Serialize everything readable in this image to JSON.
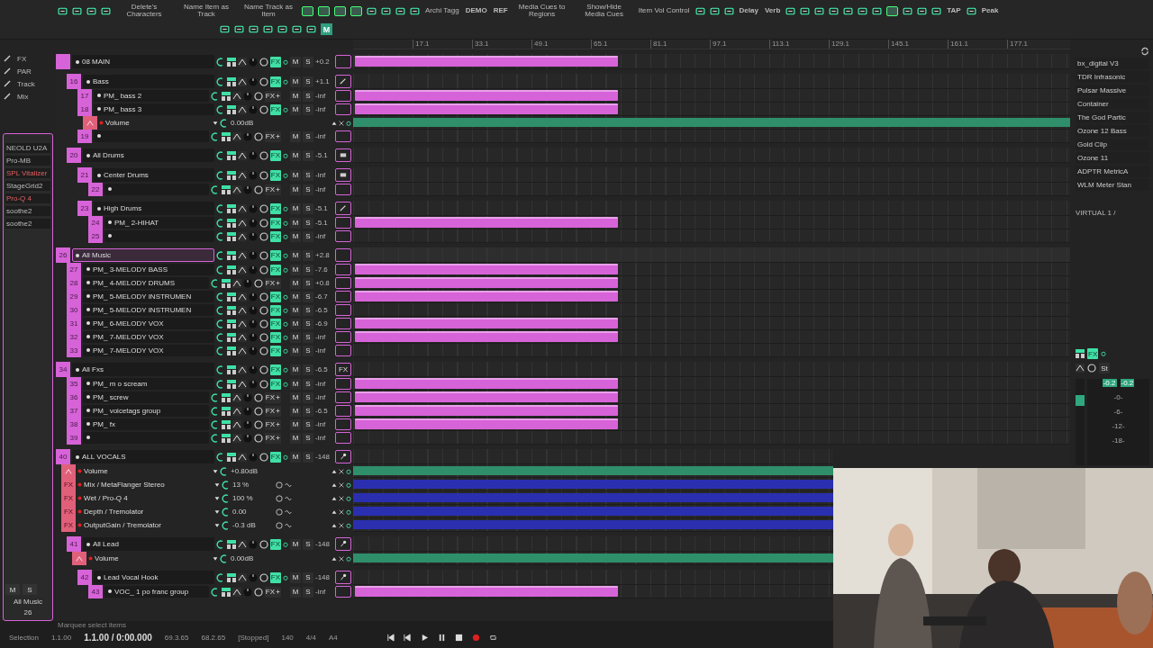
{
  "toolbar": [
    {
      "kind": "icon"
    },
    {
      "kind": "icon"
    },
    {
      "kind": "icon"
    },
    {
      "kind": "icon"
    },
    {
      "kind": "text",
      "label": "Delete's Characters"
    },
    {
      "kind": "text",
      "label": "Name Item as Track"
    },
    {
      "kind": "text",
      "label": "Name Track as Item"
    },
    {
      "kind": "toggle"
    },
    {
      "kind": "toggle"
    },
    {
      "kind": "toggle"
    },
    {
      "kind": "toggle"
    },
    {
      "kind": "icon"
    },
    {
      "kind": "icon"
    },
    {
      "kind": "icon"
    },
    {
      "kind": "icon"
    },
    {
      "kind": "text",
      "label": "Archi Tagg"
    },
    {
      "kind": "text",
      "label": "DEMO"
    },
    {
      "kind": "text",
      "label": "REF"
    },
    {
      "kind": "text",
      "label": "Media Cues to Regions"
    },
    {
      "kind": "text",
      "label": "Show/Hide Media Cues"
    },
    {
      "kind": "text",
      "label": "Item Vol Control"
    },
    {
      "kind": "icon"
    },
    {
      "kind": "icon"
    },
    {
      "kind": "icon"
    },
    {
      "kind": "text",
      "label": "Delay"
    },
    {
      "kind": "text",
      "label": "Verb"
    },
    {
      "kind": "icon"
    },
    {
      "kind": "icon"
    },
    {
      "kind": "icon"
    },
    {
      "kind": "icon"
    },
    {
      "kind": "icon"
    },
    {
      "kind": "icon"
    },
    {
      "kind": "icon"
    },
    {
      "kind": "toggle"
    },
    {
      "kind": "icon"
    },
    {
      "kind": "icon"
    },
    {
      "kind": "icon"
    },
    {
      "kind": "text",
      "label": "TAP"
    },
    {
      "kind": "icon"
    },
    {
      "kind": "text",
      "label": "Peak"
    }
  ],
  "toolbar2": [
    {
      "kind": "icon"
    },
    {
      "kind": "icon"
    },
    {
      "kind": "icon"
    },
    {
      "kind": "icon"
    },
    {
      "kind": "icon"
    },
    {
      "kind": "icon"
    },
    {
      "kind": "icon"
    },
    {
      "kind": "text",
      "label": "M"
    }
  ],
  "left_tools": {
    "labels": [
      "FX",
      "PAR",
      "Track",
      "Mix"
    ]
  },
  "left_strip": {
    "fx": [
      {
        "name": "NEOLD U2A",
        "enabled": true
      },
      {
        "name": "Pro-MB",
        "enabled": true
      },
      {
        "name": "SPL Vitalizer",
        "enabled": false
      },
      {
        "name": "StageGrid2",
        "enabled": true
      },
      {
        "name": "Pro-Q 4",
        "enabled": false
      },
      {
        "name": "soothe2",
        "enabled": true
      },
      {
        "name": "soothe2",
        "enabled": true
      }
    ],
    "buttons": [
      "M",
      "S"
    ],
    "track_name": "All Music",
    "track_number": "26"
  },
  "ruler": [
    "17.1",
    "33.1",
    "49.1",
    "65.1",
    "81.1",
    "97.1",
    "113.1",
    "129.1",
    "145.1",
    "161.1",
    "177.1"
  ],
  "tracks": [
    {
      "name": "08 MAIN",
      "reading": "+0.2",
      "fx": "FX",
      "mute": "M",
      "solo": "S",
      "fx_on": true,
      "selected": false,
      "items": true,
      "children": [
        {
          "number": "16",
          "name": "Bass",
          "reading": "+1.1",
          "fx": "FX",
          "mute": "M",
          "solo": "S",
          "fx_on": true,
          "selected": false,
          "items": false,
          "thumb": {
            "kind": "guitar"
          },
          "children": [
            {
              "number": "17",
              "name": "PM_ bass 2",
              "reading": "-inf",
              "fx": "FX",
              "mute": "M",
              "solo": "S",
              "fx_on": false,
              "selected": false,
              "items": true
            },
            {
              "number": "18",
              "name": "PM_ bass 3",
              "reading": "-inf",
              "fx": "FX",
              "mute": "M",
              "solo": "S",
              "fx_on": true,
              "selected": false,
              "items": true,
              "envelopes": [
                {
                  "kind": "volume",
                  "name": "Volume",
                  "value": "0.00dB"
                }
              ]
            },
            {
              "number": "19",
              "reading": "-inf",
              "fx": "FX",
              "mute": "M",
              "solo": "S",
              "fx_on": false,
              "selected": false,
              "items": false
            }
          ]
        },
        {
          "number": "20",
          "name": "All Drums",
          "reading": "-5.1",
          "fx": "FX",
          "mute": "M",
          "solo": "S",
          "fx_on": true,
          "selected": false,
          "items": false,
          "thumb": {
            "kind": "drum"
          },
          "children": [
            {
              "number": "21",
              "name": "Center Drums",
              "reading": "-inf",
              "fx": "FX",
              "mute": "M",
              "solo": "S",
              "fx_on": true,
              "selected": false,
              "items": false,
              "thumb": {
                "kind": "drum"
              },
              "children": [
                {
                  "number": "22",
                  "reading": "-inf",
                  "fx": "FX",
                  "mute": "M",
                  "solo": "S",
                  "fx_on": false,
                  "selected": false,
                  "items": false
                }
              ]
            },
            {
              "number": "23",
              "name": "High Drums",
              "reading": "-5.1",
              "fx": "FX",
              "mute": "M",
              "solo": "S",
              "fx_on": true,
              "selected": false,
              "items": false,
              "thumb": {
                "kind": "guitar"
              },
              "children": [
                {
                  "number": "24",
                  "name": "PM_ 2-HIHAT",
                  "reading": "-5.1",
                  "fx": "FX",
                  "mute": "M",
                  "solo": "S",
                  "fx_on": true,
                  "selected": false,
                  "items": true
                },
                {
                  "number": "25",
                  "reading": "-inf",
                  "fx": "FX",
                  "mute": "M",
                  "solo": "S",
                  "fx_on": true,
                  "selected": false,
                  "items": false
                }
              ]
            }
          ]
        }
      ]
    },
    {
      "number": "26",
      "name": "All Music",
      "reading": "+2.8",
      "fx": "FX",
      "mute": "M",
      "solo": "S",
      "fx_on": true,
      "selected": true,
      "items": false,
      "children": [
        {
          "number": "27",
          "name": "PM_ 3-MELODY BASS",
          "reading": "-7.6",
          "fx": "FX",
          "mute": "M",
          "solo": "S",
          "fx_on": true,
          "selected": false,
          "items": true
        },
        {
          "number": "28",
          "name": "PM_ 4-MELODY DRUMS",
          "reading": "+0.8",
          "fx": "FX",
          "mute": "M",
          "solo": "S",
          "fx_on": false,
          "selected": false,
          "items": true
        },
        {
          "number": "29",
          "name": "PM_ 5-MELODY INSTRUMEN",
          "reading": "-6.7",
          "fx": "FX",
          "mute": "M",
          "solo": "S",
          "fx_on": true,
          "selected": false,
          "items": true
        },
        {
          "number": "30",
          "name": "PM_ 5-MELODY INSTRUMEN",
          "reading": "-6.5",
          "fx": "FX",
          "mute": "M",
          "solo": "S",
          "fx_on": true,
          "selected": false,
          "items": false
        },
        {
          "number": "31",
          "name": "PM_ 6-MELODY VOX",
          "reading": "-6.9",
          "fx": "FX",
          "mute": "M",
          "solo": "S",
          "fx_on": true,
          "selected": false,
          "items": true
        },
        {
          "number": "32",
          "name": "PM_ 7-MELODY VOX",
          "reading": "-inf",
          "fx": "FX",
          "mute": "M",
          "solo": "S",
          "fx_on": true,
          "selected": false,
          "items": true
        },
        {
          "number": "33",
          "name": "PM_ 7-MELODY VOX",
          "reading": "-inf",
          "fx": "FX",
          "mute": "M",
          "solo": "S",
          "fx_on": true,
          "selected": false,
          "items": false
        }
      ]
    },
    {
      "number": "34",
      "name": "All Fxs",
      "reading": "-6.5",
      "fx": "FX",
      "mute": "M",
      "solo": "S",
      "fx_on": true,
      "selected": false,
      "items": false,
      "thumb": {
        "kind": "text",
        "label": "FX"
      },
      "children": [
        {
          "number": "35",
          "name": "PM_ m o scream",
          "reading": "-inf",
          "fx": "FX",
          "mute": "M",
          "solo": "S",
          "fx_on": true,
          "selected": false,
          "items": true
        },
        {
          "number": "36",
          "name": "PM_ screw",
          "reading": "-inf",
          "fx": "FX",
          "mute": "M",
          "solo": "S",
          "fx_on": false,
          "selected": false,
          "items": true
        },
        {
          "number": "37",
          "name": "PM_ voicetags group",
          "reading": "-6.5",
          "fx": "FX",
          "mute": "M",
          "solo": "S",
          "fx_on": false,
          "selected": false,
          "items": true
        },
        {
          "number": "38",
          "name": "PM_ fx",
          "reading": "-inf",
          "fx": "FX",
          "mute": "M",
          "solo": "S",
          "fx_on": false,
          "selected": false,
          "items": true
        },
        {
          "number": "39",
          "reading": "-inf",
          "fx": "FX",
          "mute": "M",
          "solo": "S",
          "fx_on": false,
          "selected": false,
          "items": false
        }
      ]
    },
    {
      "number": "40",
      "name": "ALL VOCALS",
      "reading": "-148",
      "fx": "FX",
      "mute": "M",
      "solo": "S",
      "fx_on": true,
      "selected": false,
      "items": false,
      "thumb": {
        "kind": "mic"
      },
      "envelopes": [
        {
          "kind": "volume",
          "name": "Volume",
          "value": "+0.80dB"
        },
        {
          "kind": "fx",
          "badge": "FX",
          "name": "Mix / MetaFlanger Stereo",
          "value": "13 %"
        },
        {
          "kind": "fx",
          "badge": "FX",
          "name": "Wet / Pro-Q 4",
          "value": "100 %"
        },
        {
          "kind": "fx",
          "badge": "FX",
          "name": "Depth / Tremolator",
          "value": "0.00"
        },
        {
          "kind": "fx",
          "badge": "FX",
          "name": "OutputGain / Tremolator",
          "value": "-0.3  dB"
        }
      ],
      "children": [
        {
          "number": "41",
          "name": "All Lead",
          "reading": "-148",
          "fx": "FX",
          "mute": "M",
          "solo": "S",
          "fx_on": true,
          "selected": false,
          "items": false,
          "thumb": {
            "kind": "mic"
          },
          "envelopes": [
            {
              "kind": "volume",
              "name": "Volume",
              "value": "0.00dB"
            }
          ],
          "children": [
            {
              "number": "42",
              "name": "Lead Vocal Hook",
              "reading": "-148",
              "fx": "FX",
              "mute": "M",
              "solo": "S",
              "fx_on": true,
              "selected": false,
              "items": false,
              "thumb": {
                "kind": "mic"
              },
              "children": [
                {
                  "number": "43",
                  "name": "VOC_ 1 po franc group",
                  "reading": "-inf",
                  "fx": "FX",
                  "mute": "M",
                  "solo": "S",
                  "fx_on": false,
                  "selected": false,
                  "items": true
                }
              ]
            }
          ]
        }
      ]
    }
  ],
  "right_panel": {
    "fx": [
      "bx_digital V3",
      "TDR Infrasonic",
      "Pulsar Massive",
      "Container",
      "The God Partic",
      "Ozone 12 Bass",
      "Gold Clip",
      "Ozone 11",
      "ADPTR MetricA",
      "WLM Meter Stan"
    ],
    "input": "VIRTUAL 1 /",
    "fx_button": "FX",
    "stereo": "St",
    "peaks": [
      "-0.2",
      "-0.2"
    ],
    "scale": [
      "-0-",
      "-6-",
      "-12-",
      "-18-"
    ]
  },
  "status": {
    "hint": "Marquee select items",
    "selection": "Selection",
    "start": "1.1.00",
    "position": "1.1.00 / 0:00.000",
    "end": "69.3.65",
    "length": "68.2.65",
    "state": "[Stopped]",
    "tempo": "140",
    "signature": "4/4",
    "key": "A4"
  }
}
